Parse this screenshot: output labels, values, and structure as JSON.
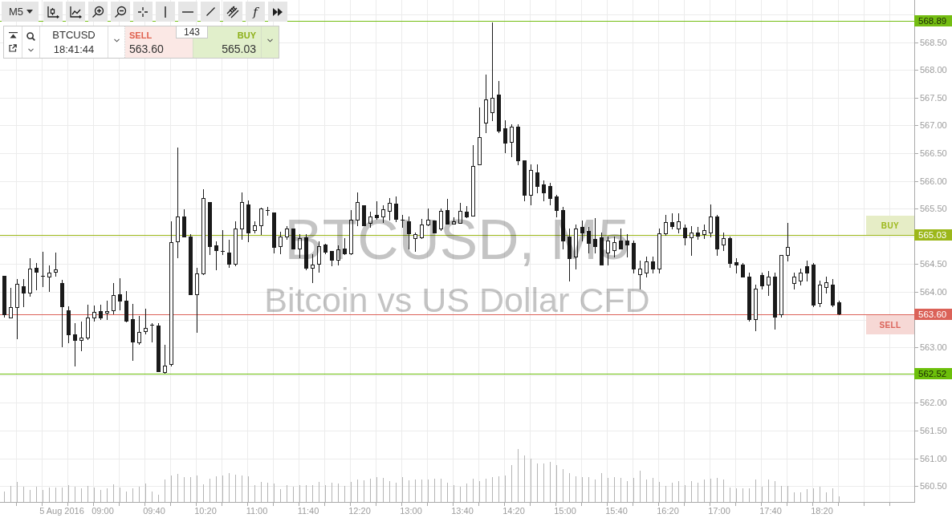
{
  "toolbar": {
    "timeframe": "M5",
    "indicators_glyph": "f"
  },
  "trade_panel": {
    "symbol": "BTCUSD",
    "time": "18:41:44",
    "sell": {
      "label": "SELL",
      "price": "563.60"
    },
    "spread": "143",
    "buy": {
      "label": "BUY",
      "price": "565.03"
    }
  },
  "chart": {
    "watermark": {
      "symbol": "BTCUSD, M5",
      "description": "Bitcoin vs US Dollar CFD"
    },
    "price_lines": [
      {
        "kind": "high",
        "tag": "568.89",
        "color": "#74bd12"
      },
      {
        "kind": "buy",
        "tag": "565.03",
        "label": "BUY",
        "color": "#9cb71a"
      },
      {
        "kind": "sell",
        "tag": "563.60",
        "label": "SELL",
        "color": "#db6258"
      },
      {
        "kind": "low",
        "tag": "562.52",
        "color": "#6cbf0a"
      }
    ],
    "price_axis": [
      "568.50",
      "568.00",
      "567.50",
      "567.00",
      "566.50",
      "566.00",
      "565.50",
      "564.50",
      "564.00",
      "563.00",
      "562.00",
      "561.50",
      "561.00",
      "560.50"
    ],
    "time_axis": [
      "5 Aug 2016",
      "09:00",
      "09:40",
      "10:20",
      "11:00",
      "11:40",
      "12:20",
      "13:00",
      "13:40",
      "14:20",
      "15:00",
      "15:40",
      "16:20",
      "17:00",
      "17:40",
      "18:20"
    ]
  }
}
